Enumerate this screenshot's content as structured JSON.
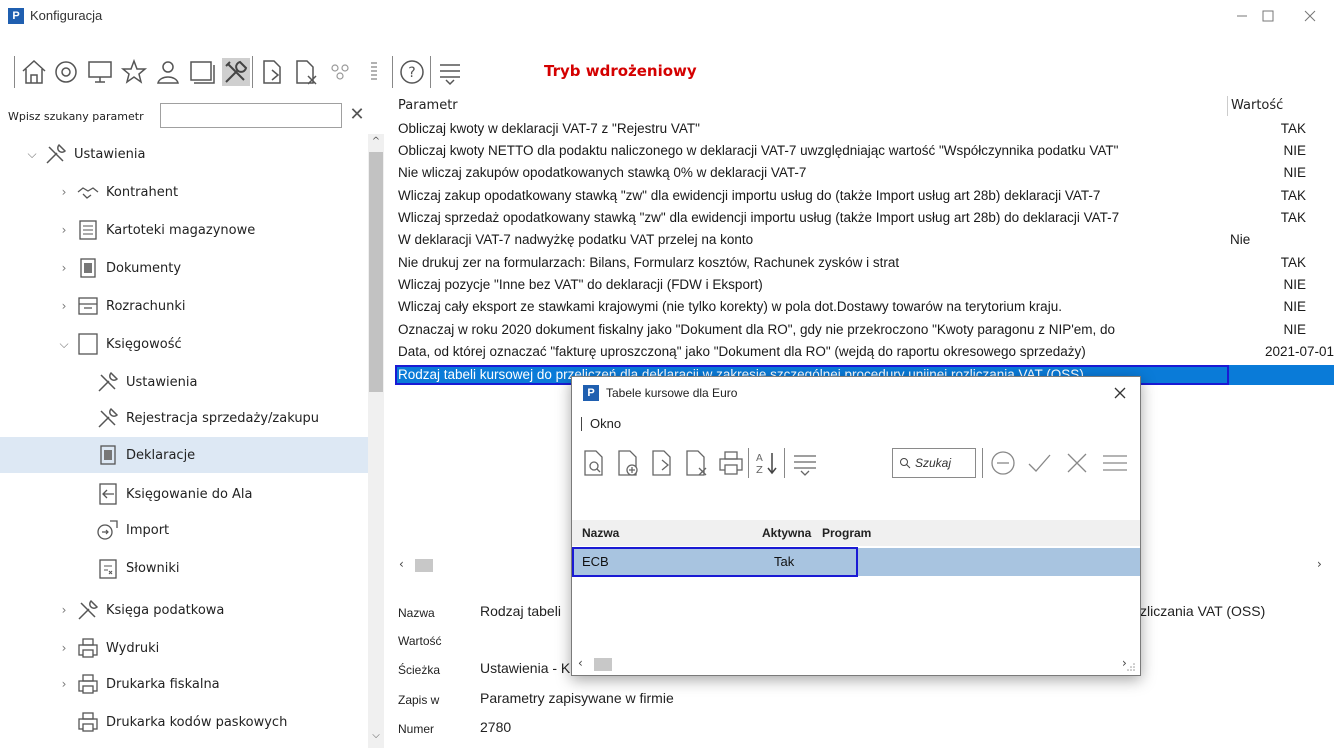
{
  "window": {
    "title": "Konfiguracja",
    "logo_letter": "P"
  },
  "toolbar": {
    "mode_label": "Tryb wdrożeniowy",
    "icons": [
      "home-icon",
      "at-icon",
      "monitor-icon",
      "star-icon",
      "user-icon",
      "window-icon",
      "tools-icon",
      "document-arrow-icon",
      "document-x-icon",
      "users-icon",
      "list-icon",
      "help-icon",
      "menu-icon"
    ]
  },
  "search": {
    "label": "Wpisz szukany parametr",
    "value": "",
    "clear": "✕"
  },
  "tree": {
    "root": "Ustawienia",
    "items": [
      {
        "label": "Kontrahent"
      },
      {
        "label": "Kartoteki magazynowe"
      },
      {
        "label": "Dokumenty"
      },
      {
        "label": "Rozrachunki"
      },
      {
        "label": "Księgowość"
      },
      {
        "label": "Ustawienia"
      },
      {
        "label": "Rejestracja sprzedaży/zakupu"
      },
      {
        "label": "Deklaracje"
      },
      {
        "label": "Księgowanie do Ala"
      },
      {
        "label": "Import"
      },
      {
        "label": "Słowniki"
      },
      {
        "label": "Księga podatkowa"
      },
      {
        "label": "Wydruki"
      },
      {
        "label": "Drukarka fiskalna"
      },
      {
        "label": "Drukarka kodów paskowych"
      }
    ]
  },
  "grid": {
    "headers": {
      "param": "Parametr",
      "value": "Wartość"
    },
    "rows": [
      {
        "param": "Obliczaj kwoty w deklaracji VAT-7 z \"Rejestru VAT\"",
        "value": "TAK"
      },
      {
        "param": "Obliczaj kwoty NETTO dla podaktu naliczonego w deklaracji VAT-7 uwzględniając wartość \"Współczynnika podatku VAT\"",
        "value": "NIE"
      },
      {
        "param": "Nie wliczaj zakupów opodatkowanych stawką 0% w deklaracji VAT-7",
        "value": "NIE"
      },
      {
        "param": "Wliczaj zakup opodatkowany stawką \"zw\" dla ewidencji importu usług do (także Import usług art 28b) deklaracji VAT-7",
        "value": "TAK"
      },
      {
        "param": "Wliczaj sprzedaż opodatkowany stawką \"zw\" dla ewidencji importu usług (także Import usług art 28b) do deklaracji VAT-7",
        "value": "TAK"
      },
      {
        "param": "W deklaracji VAT-7 nadwyżkę podatku VAT przelej na konto",
        "value": "Nie"
      },
      {
        "param": "Nie drukuj zer na formularzach: Bilans, Formularz kosztów, Rachunek zysków i strat",
        "value": "TAK"
      },
      {
        "param": "Wliczaj pozycje \"Inne bez VAT\" do deklaracji (FDW i Eksport)",
        "value": "NIE"
      },
      {
        "param": "Wliczaj cały eksport ze stawkami krajowymi (nie tylko korekty) w pola dot.Dostawy towarów na terytorium kraju.",
        "value": "NIE"
      },
      {
        "param": "Oznaczaj w roku 2020 dokument fiskalny jako \"Dokument dla RO\", gdy nie przekroczono \"Kwoty paragonu z NIP'em, do",
        "value": "NIE"
      },
      {
        "param": "Data, od której oznaczać \"fakturę uproszczoną\" jako \"Dokument dla RO\" (wejdą do raportu okresowego sprzedaży)",
        "value": "2021-07-01"
      },
      {
        "param": "Rodzaj tabeli kursowej do przeliczeń dla deklaracji w zakresie szczególnej procedury unijnej rozliczania VAT (OSS)",
        "value": ""
      }
    ]
  },
  "details": {
    "name_label": "Nazwa",
    "name_value": "Rodzaj tabeli",
    "name_value_tail": "zliczania VAT (OSS)",
    "value_label": "Wartość",
    "path_label": "Ścieżka",
    "path_value": "Ustawienia - K",
    "save_label": "Zapis w",
    "save_value": "Parametry zapisywane w firmie",
    "number_label": "Numer",
    "number_value": "2780"
  },
  "modal": {
    "title": "Tabele kursowe dla Euro",
    "menu": "Okno",
    "search_placeholder": "Szukaj",
    "columns": {
      "name": "Nazwa",
      "active": "Aktywna",
      "program": "Program"
    },
    "rows": [
      {
        "name": "ECB",
        "active": "Tak",
        "program": ""
      }
    ]
  },
  "colors": {
    "selection": "#0a7bd8",
    "mode_label": "#d40000",
    "logo": "#1f5fb0",
    "highlight_outline": "#1a1ad4"
  }
}
